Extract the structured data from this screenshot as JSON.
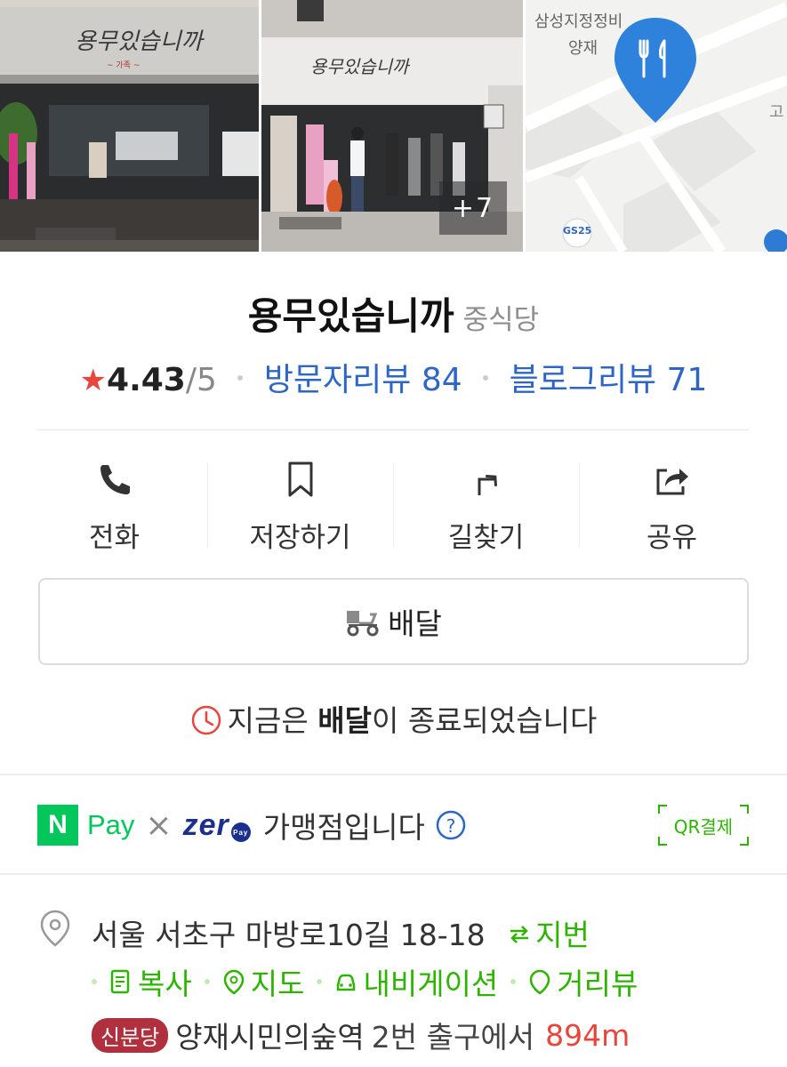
{
  "photos": {
    "more_count": "+7",
    "storefront_sign": "용무있습니까",
    "map_labels": {
      "building": "삼성지정정비",
      "area": "양재",
      "store": "GS25"
    }
  },
  "place": {
    "name": "용무있습니까",
    "category": "중식당",
    "rating": "4.43",
    "rating_max": "/5",
    "visitor_reviews_label": "방문자리뷰 84",
    "blog_reviews_label": "블로그리뷰 71"
  },
  "actions": [
    {
      "label": "전화",
      "icon": "phone-icon"
    },
    {
      "label": "저장하기",
      "icon": "bookmark-icon"
    },
    {
      "label": "길찾기",
      "icon": "directions-icon"
    },
    {
      "label": "공유",
      "icon": "share-icon"
    }
  ],
  "delivery": {
    "button_label": "배달",
    "notice_prefix": "지금은 ",
    "notice_bold": "배달",
    "notice_suffix": "이 종료되었습니다"
  },
  "pay": {
    "npay_n": "N",
    "npay_text": "Pay",
    "times": "×",
    "zero_text": "zer",
    "zero_badge": "Pay",
    "merchant_text": "가맹점입니다",
    "qr_label": "QR결제"
  },
  "address": {
    "road": "서울 서초구 마방로10길 18-18",
    "jibun_label": "지번",
    "links": [
      "복사",
      "지도",
      "내비게이션",
      "거리뷰"
    ],
    "subway_line": "신분당",
    "subway_station": "양재시민의숲역",
    "subway_exit": "2번 출구에서",
    "subway_distance": "894m"
  },
  "colors": {
    "accent_green": "#2db400",
    "link_blue": "#2e66c6",
    "star_red": "#e8453c",
    "line_badge": "#b0303d",
    "naver_green": "#03c75a",
    "zero_blue": "#1b2f8f"
  }
}
